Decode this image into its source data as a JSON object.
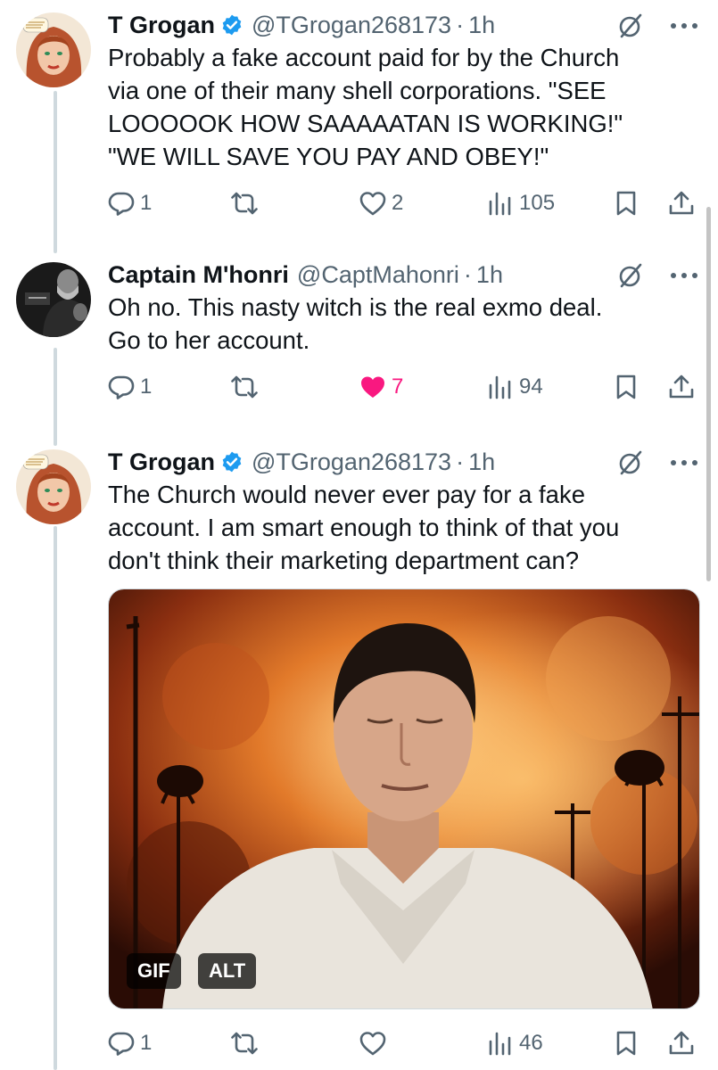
{
  "tweets": [
    {
      "author": "T Grogan",
      "handle": "@TGrogan268173",
      "separator": "·",
      "time": "1h",
      "verified": true,
      "text": "Probably a fake account paid for by the Church\nvia one of their many shell corporations. \"SEE\nLOOOOOK HOW SAAAAATAN IS WORKING!\"\n\"WE WILL SAVE YOU PAY AND OBEY!\"",
      "replies": "1",
      "retweets": "",
      "likes": "2",
      "liked": false,
      "views": "105"
    },
    {
      "author": "Captain M'honri",
      "handle": "@CaptMahonri",
      "separator": "·",
      "time": "1h",
      "verified": false,
      "text": "Oh no. This nasty witch is the real exmo deal.\nGo to her account.",
      "replies": "1",
      "retweets": "",
      "likes": "7",
      "liked": true,
      "views": "94"
    },
    {
      "author": "T Grogan",
      "handle": "@TGrogan268173",
      "separator": "·",
      "time": "1h",
      "verified": true,
      "text": "The Church would never ever pay for a fake\naccount. I am smart enough to think of that you\ndon't think their marketing department can?",
      "replies": "1",
      "retweets": "",
      "likes": "",
      "liked": false,
      "views": "46",
      "media": {
        "gif_badge": "GIF",
        "alt_badge": "ALT"
      }
    }
  ],
  "icons": {
    "reply": "reply-icon",
    "retweet": "retweet-icon",
    "like": "heart-icon",
    "views": "views-icon",
    "bookmark": "bookmark-icon",
    "share": "share-icon",
    "grok": "grok-icon",
    "more": "more-icon",
    "verified": "verified-badge-icon"
  },
  "colors": {
    "text": "#0f1419",
    "secondary": "#536471",
    "verified": "#1d9bf0",
    "liked": "#f91880",
    "thread_line": "#cfd9de"
  }
}
